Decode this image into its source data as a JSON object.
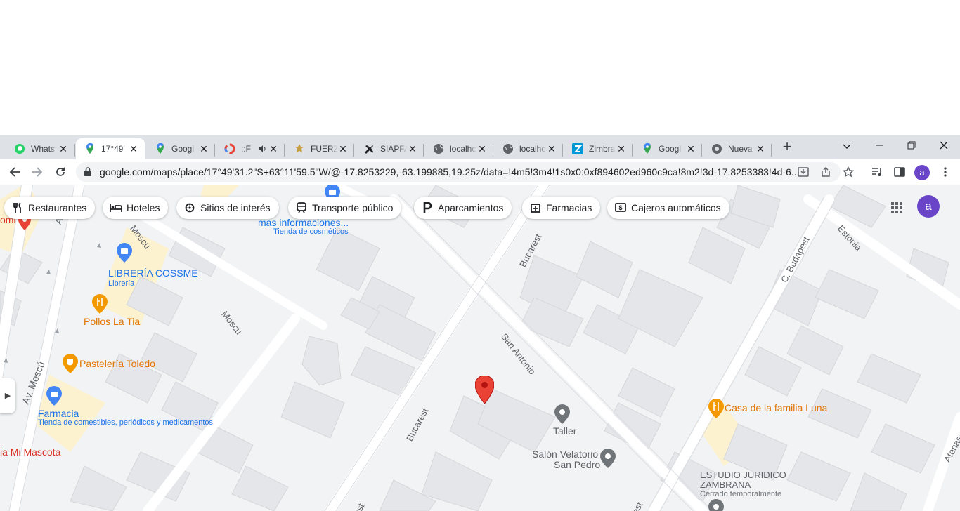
{
  "browser": {
    "tabs": [
      {
        "title": "Whats",
        "icon": "whatsapp-icon",
        "active": false
      },
      {
        "title": "17°49'",
        "icon": "google-maps-icon",
        "active": true
      },
      {
        "title": "Googl",
        "icon": "google-maps-icon",
        "active": false
      },
      {
        "title": "::F",
        "icon": "app-icon",
        "active": false,
        "audio": true
      },
      {
        "title": "FUERZ",
        "icon": "emblem-icon",
        "active": false
      },
      {
        "title": "SIAPFA",
        "icon": "plane-icon",
        "active": false
      },
      {
        "title": "localhc",
        "icon": "globe-icon",
        "active": false
      },
      {
        "title": "localhc",
        "icon": "globe-icon",
        "active": false
      },
      {
        "title": "Zimbra",
        "icon": "zimbra-icon",
        "active": false
      },
      {
        "title": "Googl",
        "icon": "google-maps-icon",
        "active": false
      },
      {
        "title": "Nueva",
        "icon": "chrome-icon",
        "active": false
      }
    ],
    "new_tab": "+",
    "url": "google.com/maps/place/17°49'31.2\"S+63°11'59.5\"W/@-17.8253229,-63.199885,19.25z/data=!4m5!3m4!1s0x0:0xf894602ed960c9ca!8m2!3d-17.8253383!4d-6...",
    "profile_initial": "a"
  },
  "map": {
    "category_chips": [
      {
        "label": "Restaurantes",
        "icon": "fork-knife-icon"
      },
      {
        "label": "Hoteles",
        "icon": "bed-icon"
      },
      {
        "label": "Sitios de interés",
        "icon": "landmark-icon"
      },
      {
        "label": "Transporte público",
        "icon": "train-icon"
      },
      {
        "label": "Aparcamientos",
        "icon": "parking-icon"
      },
      {
        "label": "Farmacias",
        "icon": "pharmacy-icon"
      },
      {
        "label": "Cajeros automáticos",
        "icon": "atm-icon"
      }
    ],
    "account_initial": "a",
    "streets": {
      "av_moscu_1": "Av. Mo",
      "av_moscu_2": "Av. Moscú",
      "moscu_1": "Moscu",
      "moscu_2": "Moscu",
      "bucarest_1": "Bucarest",
      "bucarest_2": "Bucarest",
      "bucarest_3": "est",
      "bucarest_4": "est",
      "san_antonio": "San Antonio",
      "budapest": "C. Budapest",
      "estonia": "Estonia",
      "atenas": "Atenas"
    },
    "places": {
      "cosmetics_name": "mas informaciones...",
      "cosmetics_type": "Tienda de cosméticos",
      "libreria_name": "LIBRERÍA COSSME",
      "libreria_type": "Librería",
      "pollos": "Pollos La Tia",
      "pasteleria": "Pastelería Toledo",
      "farmacia_name": "Farmacia",
      "farmacia_type": "Tienda de comestibles, periódicos y medicamentos",
      "mascota": "ia Mi Mascota",
      "partial_left": "omi",
      "taller": "Taller",
      "velatorio_1": "Salón Velatorio",
      "velatorio_2": "San Pedro",
      "casa_luna": "Casa de la familia Luna",
      "estudio_1": "ESTUDIO JURIDICO",
      "estudio_2": "ZAMBRANA",
      "estudio_status": "Cerrado temporalmente"
    },
    "colors": {
      "pin": "#ea4335",
      "road": "#ffffff",
      "block": "#e8eaed",
      "building": "#dadce0",
      "highlight": "#fdf2d0"
    }
  }
}
